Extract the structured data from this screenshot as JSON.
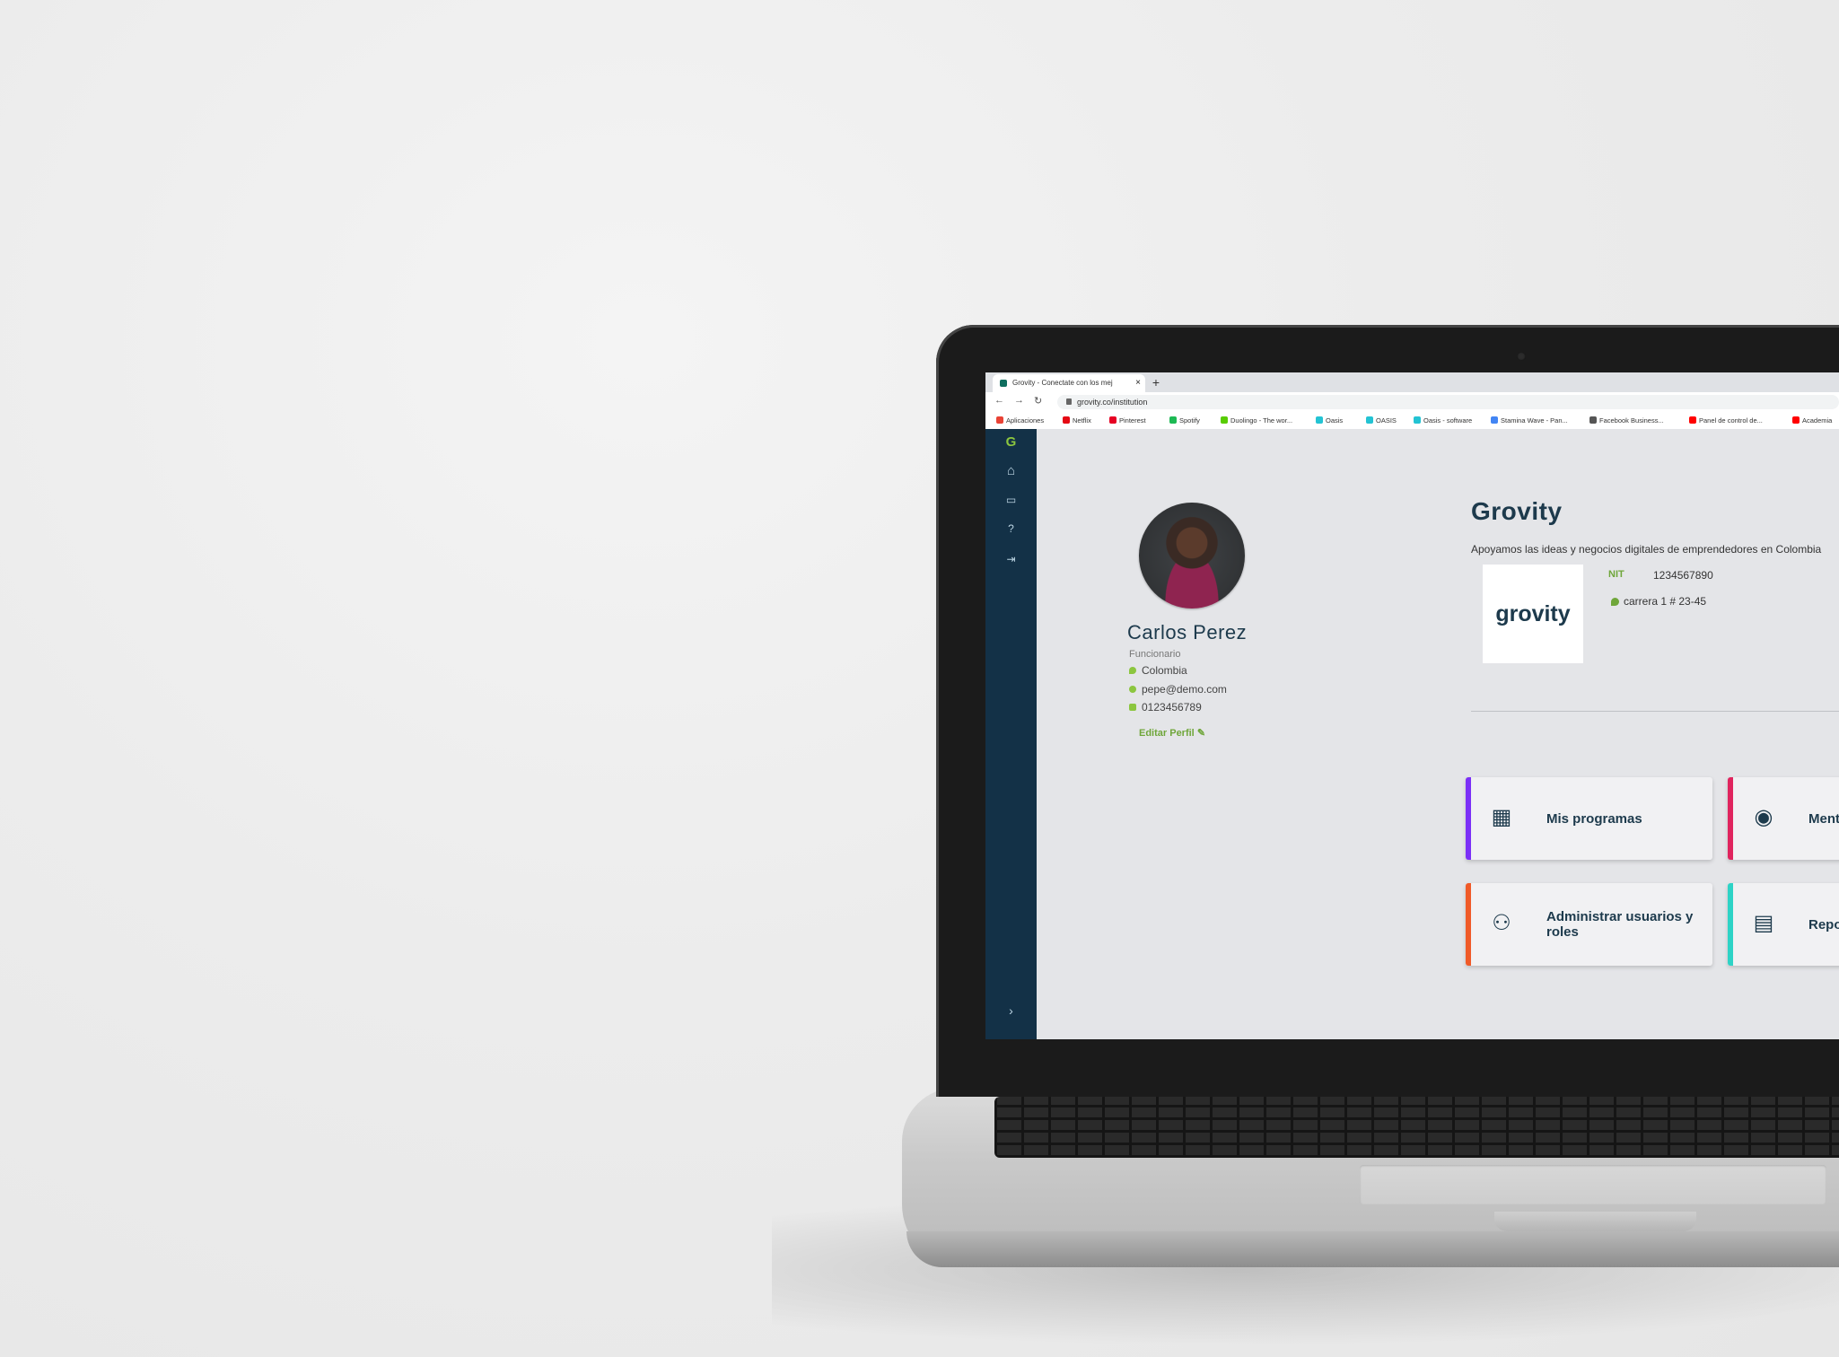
{
  "browser": {
    "tab_title": "Grovity - Conectate con los mej",
    "tab_close": "×",
    "new_tab": "+",
    "url": "grovity.co/institution",
    "bookmarks": [
      {
        "label": "Aplicaciones",
        "color": "#e94235"
      },
      {
        "label": "Netflix",
        "color": "#e50914"
      },
      {
        "label": "Pinterest",
        "color": "#e60023"
      },
      {
        "label": "Spotify",
        "color": "#1db954"
      },
      {
        "label": "Duolingo - The wor...",
        "color": "#58cc02"
      },
      {
        "label": "Oasis",
        "color": "#23c3d3"
      },
      {
        "label": "OASIS",
        "color": "#23c3d3"
      },
      {
        "label": "Oasis - software",
        "color": "#23c3d3"
      },
      {
        "label": "Stamina Wave - Pan...",
        "color": "#4285f4"
      },
      {
        "label": "Facebook Business...",
        "color": "#555555"
      },
      {
        "label": "Panel de control de...",
        "color": "#ff0000"
      },
      {
        "label": "Academia",
        "color": "#ff0000"
      }
    ]
  },
  "sidebar": {
    "logo_icon": "grovity-logo-icon",
    "items": [
      "home-icon",
      "calendar-icon",
      "help-icon",
      "logout-icon"
    ],
    "expand_icon": "chevron-right-icon"
  },
  "profile": {
    "name": "Carlos Perez",
    "role": "Funcionario",
    "country": "Colombia",
    "email": "pepe@demo.com",
    "phone": "0123456789",
    "edit_label": "Editar Perfil"
  },
  "organization": {
    "name": "Grovity",
    "description": "Apoyamos las ideas y negocios digitales de emprendedores en Colombia",
    "logo_text": "grovity",
    "nit_label": "NIT",
    "nit_value": "1234567890",
    "address": "carrera 1 # 23-45"
  },
  "cards": [
    {
      "label": "Mis programas",
      "icon": "calendar-grid-icon",
      "accent": "#7b2ff7"
    },
    {
      "label": "Mentores",
      "icon": "person-icon",
      "accent": "#e0245e"
    },
    {
      "label": "Administrar usuarios y roles",
      "icon": "users-network-icon",
      "accent": "#f05a28"
    },
    {
      "label": "Reportes",
      "icon": "report-chart-icon",
      "accent": "#2ed3c6"
    }
  ]
}
